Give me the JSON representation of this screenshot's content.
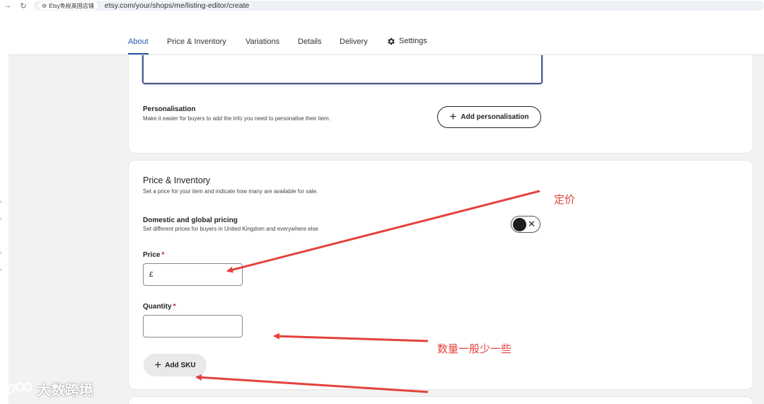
{
  "browser": {
    "site_chip": "Etsy免税英国店铺",
    "url": "etsy.com/your/shops/me/listing-editor/create"
  },
  "tabs": [
    {
      "label": "About",
      "active": true
    },
    {
      "label": "Price & Inventory"
    },
    {
      "label": "Variations"
    },
    {
      "label": "Details"
    },
    {
      "label": "Delivery"
    },
    {
      "label": "Settings",
      "icon": "gear-icon"
    }
  ],
  "personalisation": {
    "title": "Personalisation",
    "subtitle": "Make it easier for buyers to add the info you need to personalise their item.",
    "button_label": "Add personalisation"
  },
  "price_inventory": {
    "title": "Price & Inventory",
    "subtitle": "Set a price for your item and indicate how many are available for sale.",
    "pricing_toggle": {
      "title": "Domestic and global pricing",
      "subtitle": "Set different prices for buyers in United Kingdom and everywhere else",
      "state": "off"
    },
    "price": {
      "label": "Price",
      "required_mark": "*",
      "prefix": "£",
      "value": ""
    },
    "quantity": {
      "label": "Quantity",
      "required_mark": "*",
      "value": ""
    },
    "sku_button_label": "Add SKU"
  },
  "annotations": {
    "price_note": "定价",
    "quantity_note": "数量一般少一些",
    "color": "#e4423d"
  },
  "watermark": {
    "text": "大数跨境"
  },
  "colors": {
    "accent": "#2a57a8",
    "required": "#b3243c"
  }
}
